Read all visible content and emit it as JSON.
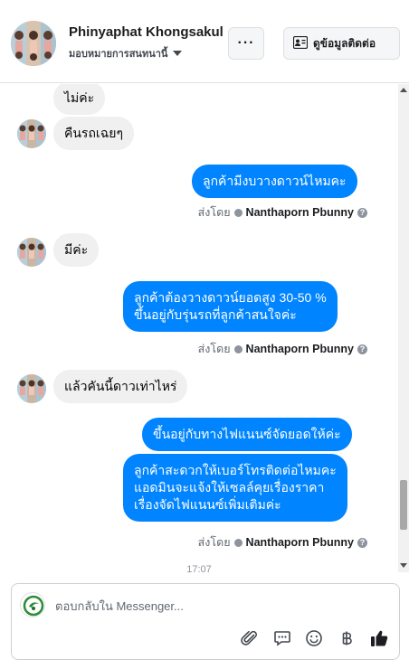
{
  "header": {
    "name": "Phinyaphat Khongsakul",
    "subtitle": "มอบหมายการสนทนานี้",
    "more_label": "···",
    "contact_label": "ดูข้อมูลติดต่อ"
  },
  "messages": [
    {
      "side": "in",
      "text": "ไม่ค่ะ"
    },
    {
      "side": "in",
      "text": "คืนรถเฉยๆ"
    },
    {
      "side": "out",
      "text": "ลูกค้ามีงบวางดาวน์ไหมคะ"
    },
    {
      "side": "in",
      "text": "มีค่ะ"
    },
    {
      "side": "out",
      "lines": [
        "ลูกค้าต้องวางดาวน์ยอดสูง 30-50 %",
        "ขึ้นอยู่กับรุ่นรถที่ลูกค้าสนใจค่ะ"
      ]
    },
    {
      "side": "in",
      "text": "แล้วคันนี้ดาวเท่าไหร่"
    },
    {
      "side": "out",
      "text": "ขึ้นอยู่กับทางไฟแนนซ์จัดยอดให้ค่ะ"
    },
    {
      "side": "out",
      "lines": [
        "ลูกค้าสะดวกให้เบอร์โทรติดต่อไหมคะ",
        "แอดมินจะแจ้งให้เซลล์คุยเรื่องราคา",
        "เรื่องจัดไฟแนนซ์เพิ่มเติมค่ะ"
      ]
    }
  ],
  "sent_by": {
    "prefix": "ส่งโดย",
    "agent": "Nanthaporn Pbunny",
    "help": "?"
  },
  "timestamp": "17:07",
  "composer": {
    "placeholder": "ตอบกลับใน Messenger..."
  },
  "tools": [
    "attachment-icon",
    "chat-bubble-icon",
    "emoji-icon",
    "baht-icon",
    "thumbs-up-icon"
  ],
  "colors": {
    "outgoing_bubble": "#0084ff",
    "incoming_bubble": "#f0f0f0",
    "brand_green": "#2e8b3a"
  }
}
